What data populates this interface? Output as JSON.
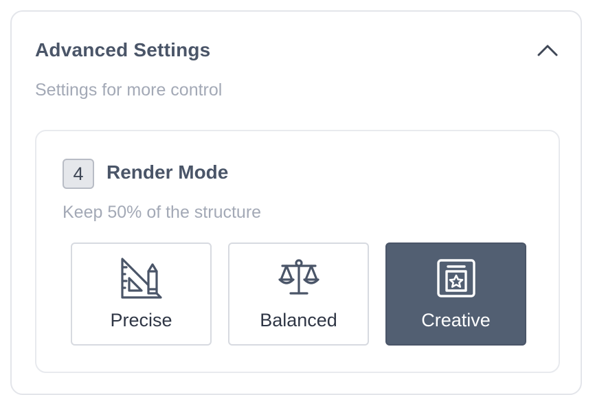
{
  "panel": {
    "title": "Advanced Settings",
    "subtitle": "Settings for more control",
    "collapse_icon": "chevron-up-icon",
    "expanded": true
  },
  "render_mode": {
    "step_number": "4",
    "title": "Render Mode",
    "description": "Keep 50% of the structure",
    "selected": "Creative",
    "options": [
      {
        "label": "Precise",
        "icon": "ruler-pencil-icon"
      },
      {
        "label": "Balanced",
        "icon": "balance-scale-icon"
      },
      {
        "label": "Creative",
        "icon": "star-frame-icon"
      }
    ]
  },
  "colors": {
    "selected_background": "#525f72",
    "text_primary": "#4a5568",
    "text_muted": "#a3a9b6",
    "border": "#e3e5ea"
  }
}
